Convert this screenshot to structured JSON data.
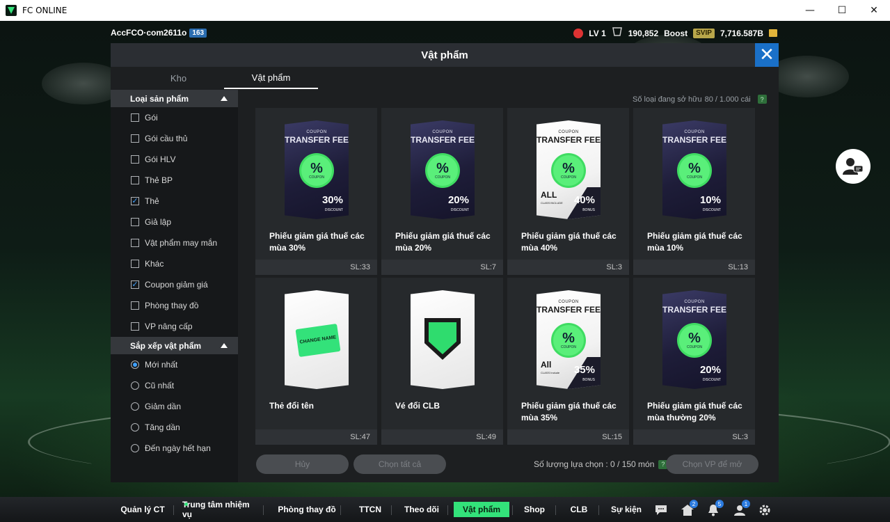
{
  "window": {
    "title": "FC ONLINE",
    "buttons": [
      "—",
      "☐",
      "✕"
    ]
  },
  "hud": {
    "username": "AccFCO·com2611o",
    "user_level_badge": "163",
    "level": "LV 1",
    "currency1": "190,852",
    "boost_label": "Boost",
    "svip_label": "SVIP",
    "gold": "7,716.587B"
  },
  "modal": {
    "title": "Vật phẩm",
    "close_label": "✕",
    "tabs": [
      {
        "label": "Kho"
      },
      {
        "label": "Vật phẩm"
      }
    ],
    "owned_label": "Số loại đang sở hữu",
    "owned_value": "80 / 1.000 cái",
    "help": "?"
  },
  "sidebar": {
    "product_type": {
      "title": "Loại sản phẩm",
      "options": [
        {
          "label": "Gói",
          "checked": false
        },
        {
          "label": "Gói cầu thủ",
          "checked": false
        },
        {
          "label": "Gói HLV",
          "checked": false
        },
        {
          "label": "Thẻ BP",
          "checked": false
        },
        {
          "label": "Thẻ",
          "checked": true
        },
        {
          "label": "Giả lập",
          "checked": false
        },
        {
          "label": "Vật phẩm may mắn",
          "checked": false
        },
        {
          "label": "Khác",
          "checked": false
        },
        {
          "label": "Coupon giảm giá",
          "checked": true
        },
        {
          "label": "Phòng thay đồ",
          "checked": false
        },
        {
          "label": "VP nâng cấp",
          "checked": false
        }
      ]
    },
    "sort": {
      "title": "Sắp xếp vật phẩm",
      "options": [
        {
          "label": "Mới nhất",
          "selected": true
        },
        {
          "label": "Cũ nhất",
          "selected": false
        },
        {
          "label": "Giảm dần",
          "selected": false
        },
        {
          "label": "Tăng dần",
          "selected": false
        },
        {
          "label": "Đến ngày hết hạn",
          "selected": false
        }
      ]
    }
  },
  "items": [
    {
      "name": "Phiếu giảm giá thuế các mùa 30%",
      "qty": "SL:33",
      "art": "coupon-dark",
      "coupon_small": "COUPON",
      "coupon_title": "TRANSFER FEE",
      "seal_sub": "COUPON",
      "percent": "30%",
      "percent_label": "DISCOUNT"
    },
    {
      "name": "Phiếu giảm giá thuế các mùa 20%",
      "qty": "SL:7",
      "art": "coupon-dark",
      "coupon_small": "COUPON",
      "coupon_title": "TRANSFER FEE",
      "seal_sub": "COUPON",
      "percent": "20%",
      "percent_label": "DISCOUNT"
    },
    {
      "name": "Phiếu giảm giá thuế các mùa 40%",
      "qty": "SL:3",
      "art": "coupon-light",
      "coupon_small": "COUPON",
      "coupon_title": "TRANSFER FEE",
      "seal_sub": "COUPON",
      "percent": "40%",
      "percent_label": "BONUS",
      "all_label": "ALL",
      "all_sub": "CLASS INCLUDE"
    },
    {
      "name": "Phiếu giảm giá thuế các mùa 10%",
      "qty": "SL:13",
      "art": "coupon-dark",
      "coupon_small": "COUPON",
      "coupon_title": "TRANSFER FEE",
      "seal_sub": "COUPON",
      "percent": "10%",
      "percent_label": "DISCOUNT"
    },
    {
      "name": "Thẻ đổi tên",
      "qty": "SL:47",
      "art": "change-name",
      "ticket_text": "CHANGE NAME"
    },
    {
      "name": "Vé đổi CLB",
      "qty": "SL:49",
      "art": "club-change"
    },
    {
      "name": "Phiếu giảm giá thuế các mùa 35%",
      "qty": "SL:15",
      "art": "coupon-light",
      "coupon_small": "COUPON",
      "coupon_title": "TRANSFER FEE",
      "seal_sub": "COUPON",
      "percent": "35%",
      "percent_label": "BONUS",
      "all_label": "All",
      "all_sub": "CLASS Include"
    },
    {
      "name": "Phiếu giảm giá thuế các mùa thường 20%",
      "qty": "SL:3",
      "art": "coupon-dark",
      "coupon_small": "COUPON",
      "coupon_title": "TRANSFER FEE",
      "seal_sub": "COUPON",
      "percent": "20%",
      "percent_label": "DISCOUNT"
    }
  ],
  "actions": {
    "cancel": "Hủy",
    "select_all": "Chọn tất cả",
    "selection_label": "Số lượng lựa chọn : 0 / 150 món",
    "choose": "Chọn VP để mở"
  },
  "bottom_nav": {
    "items": [
      {
        "label": "Quản lý CT",
        "active": false
      },
      {
        "label": "Trung tâm nhiệm vụ",
        "active": false
      },
      {
        "label": "Phòng thay đồ",
        "active": false
      },
      {
        "label": "TTCN",
        "active": false
      },
      {
        "label": "Theo dõi",
        "active": false
      },
      {
        "label": "Vật phẩm",
        "active": true
      },
      {
        "label": "Shop",
        "active": false
      },
      {
        "label": "CLB",
        "active": false
      },
      {
        "label": "Sự kiện",
        "active": false
      }
    ],
    "icons": [
      {
        "name": "chat-icon",
        "badge": ""
      },
      {
        "name": "home-icon",
        "badge": "2"
      },
      {
        "name": "bell-icon",
        "badge": "5"
      },
      {
        "name": "inbox-icon",
        "badge": "1"
      },
      {
        "name": "gear-icon",
        "badge": ""
      }
    ]
  },
  "colors": {
    "accent_green": "#33e27a",
    "close_blue": "#1a70c8",
    "check_blue": "#3fa1ff"
  }
}
